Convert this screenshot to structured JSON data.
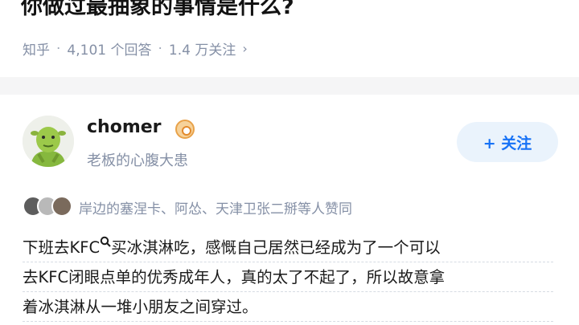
{
  "question": {
    "title": "你做过最抽象的事情是什么?",
    "source": "知乎",
    "answers": "4,101 个回答",
    "followers": "1.4 万关注",
    "chevron": "›"
  },
  "answer": {
    "author": {
      "name": "chomer",
      "bio": "老板的心腹大患"
    },
    "follow_label": "+ 关注",
    "upvote_text": "岸边的塞涅卡、阿怂、天津卫张二掰等人赞同",
    "body": {
      "line1_a": "下班去KFC",
      "line1_b": "买冰淇淋吃，感慨自己居然已经成为了一个可以",
      "line2": "去KFC闭眼点单的优秀成年人，真的太了不起了，所以故意拿",
      "line3": "着冰淇淋从一堆小朋友之间穿过。"
    }
  },
  "icons": {
    "verified": "verified-badge-icon",
    "search": "search-icon",
    "chevron": "chevron-right-icon"
  },
  "colors": {
    "accent": "#1772f6",
    "meta": "#8590a6",
    "follow_bg": "#eaf3fc"
  }
}
